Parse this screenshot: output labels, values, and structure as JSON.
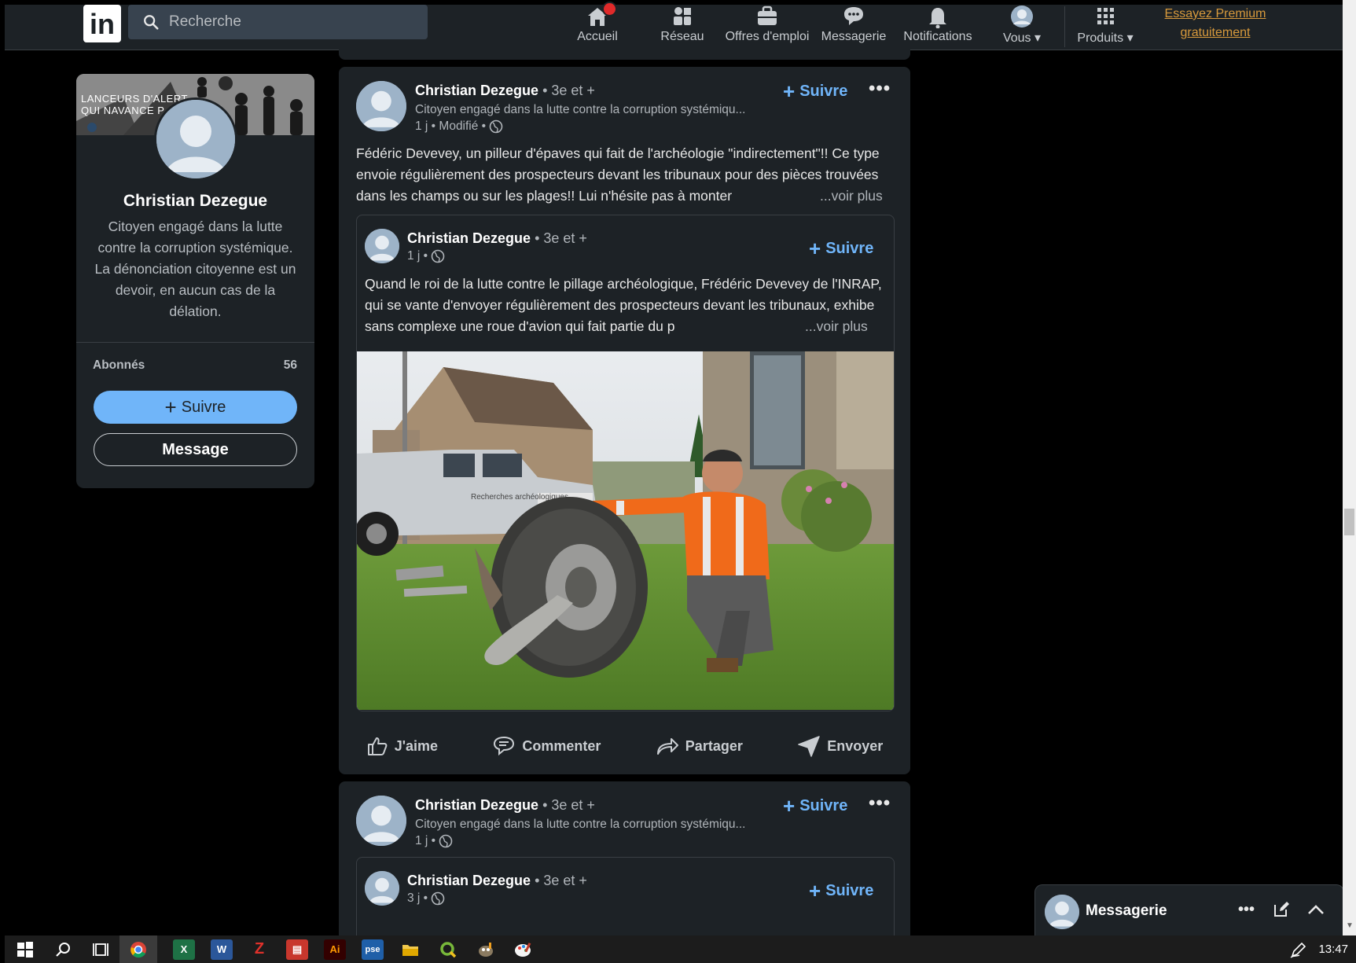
{
  "topbar": {
    "logo": "in",
    "search_placeholder": "Recherche",
    "nav": [
      "Accueil",
      "Réseau",
      "Offres d'emploi",
      "Messagerie",
      "Notifications",
      "Vous",
      "Produits"
    ],
    "premium": [
      "Essayez Premium",
      "gratuitement"
    ]
  },
  "profile_card": {
    "banner_text": [
      "LANCEURS D'ALERT",
      "QUI NAVANCE P"
    ],
    "name": "Christian Dezegue",
    "bio": "Citoyen engagé dans la lutte contre la corruption systémique. La dénonciation citoyenne est un devoir, en aucun cas de la délation.",
    "followers_label": "Abonnés",
    "followers_count": "56",
    "follow_label": "Suivre",
    "message_label": "Message"
  },
  "post1": {
    "author": "Christian Dezegue",
    "degree": "• 3e et +",
    "subtitle": "Citoyen engagé dans la lutte contre la corruption systémiqu...",
    "meta": "1 j • Modifié •",
    "follow_label": "Suivre",
    "more_label": "•••",
    "text": "Fédéric Devevey, un pilleur d'épaves qui fait de l'archéologie \"indirectement\"!! Ce type envoie régulièrement des prospecteurs devant les tribunaux pour des pièces trouvées dans les champs ou sur les plages!! Lui n'hésite pas à monter",
    "see_more": "...voir plus",
    "shared": {
      "author": "Christian Dezegue",
      "degree": "• 3e et +",
      "meta": "1 j •",
      "follow_label": "Suivre",
      "text": "Quand le roi de la lutte contre le pillage archéologique, Frédéric Devevey de l'INRAP, qui se vante d'envoyer régulièrement des prospecteurs devant les tribunaux, exhibe sans complexe une roue d'avion qui fait partie du p",
      "see_more": "...voir plus",
      "truck_text": "Recherches archéologiques"
    },
    "actions": [
      "J'aime",
      "Commenter",
      "Partager",
      "Envoyer"
    ]
  },
  "post2": {
    "author": "Christian Dezegue",
    "degree": "• 3e et +",
    "subtitle": "Citoyen engagé dans la lutte contre la corruption systémiqu...",
    "meta": "1 j •",
    "follow_label": "Suivre",
    "more_label": "•••",
    "shared": {
      "author": "Christian Dezegue",
      "degree": "• 3e et +",
      "meta": "3 j •",
      "follow_label": "Suivre"
    }
  },
  "messaging": {
    "title": "Messagerie"
  },
  "taskbar": {
    "time": "13:47"
  },
  "colors": {
    "accent": "#70b5f9",
    "card": "#1d2226",
    "premium": "#d89a3c"
  }
}
